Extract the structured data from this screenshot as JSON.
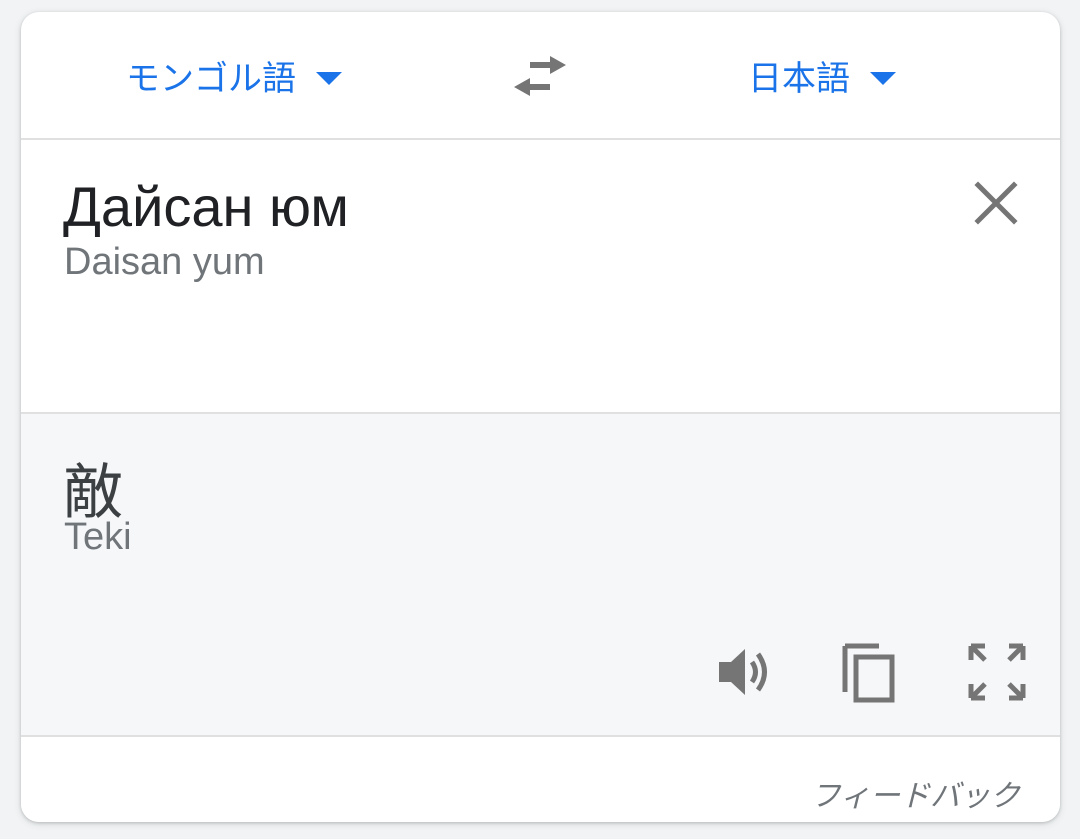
{
  "language_bar": {
    "source_language": "モンゴル語",
    "target_language": "日本語",
    "source_dropdown_icon": "arrow-drop-down",
    "target_dropdown_icon": "arrow-drop-down",
    "swap_icon": "swap-horiz"
  },
  "source": {
    "text": "Дайсан юм",
    "transliteration": "Daisan yum",
    "clear_icon": "close"
  },
  "result": {
    "text": "敵",
    "transliteration": "Teki",
    "speak_icon": "volume-up",
    "copy_icon": "content-copy",
    "fullscreen_icon": "fullscreen"
  },
  "footer": {
    "feedback_label": "フィードバック"
  },
  "colors": {
    "accent": "#1a73e8",
    "icon_gray": "#757575",
    "result_background": "#f6f7f9",
    "divider": "#e0e0e0"
  }
}
